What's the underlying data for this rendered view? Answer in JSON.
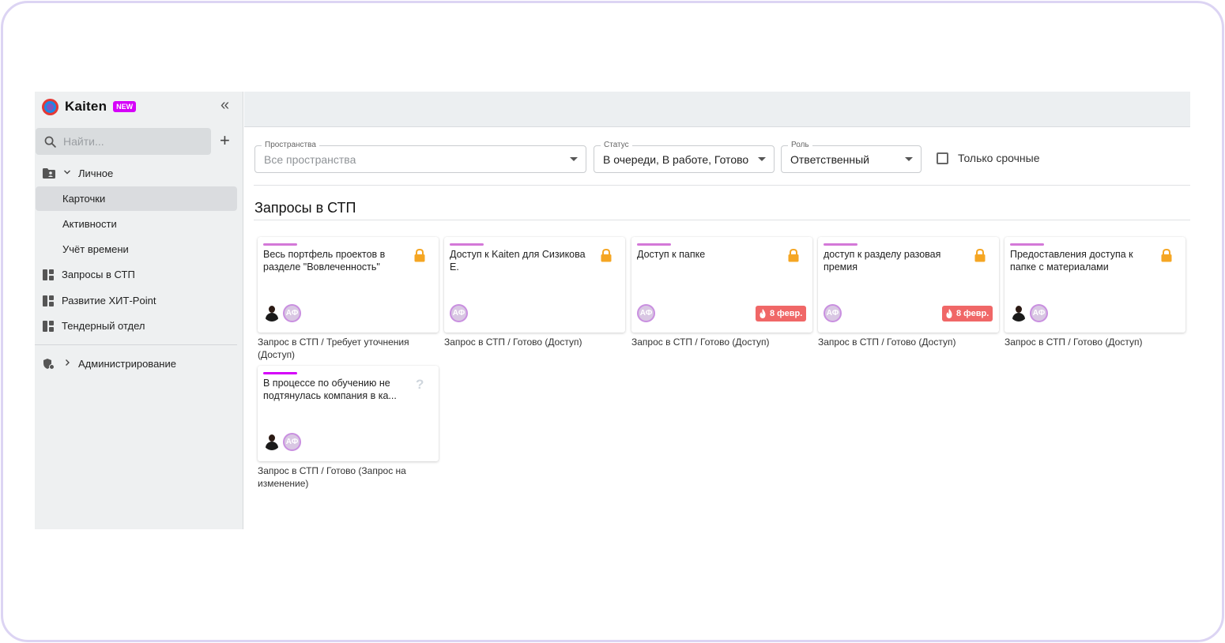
{
  "app": {
    "name": "Kaiten",
    "badge": "NEW",
    "collapse_glyph": "«"
  },
  "search": {
    "placeholder": "Найти..."
  },
  "sidebar": {
    "personal": {
      "label": "Личное"
    },
    "personal_items": [
      {
        "label": "Карточки",
        "active": true
      },
      {
        "label": "Активности"
      },
      {
        "label": "Учёт времени"
      }
    ],
    "spaces": [
      {
        "label": "Запросы в СТП",
        "icon": "board-icon"
      },
      {
        "label": "Развитие ХИТ-Point",
        "icon": "board-icon"
      },
      {
        "label": "Тендерный отдел",
        "icon": "board-icon"
      }
    ],
    "admin": {
      "label": "Администрирование",
      "icon": "admin-shield-icon"
    }
  },
  "filters": {
    "spaces": {
      "label": "Пространства",
      "placeholder": "Все пространства"
    },
    "status": {
      "label": "Статус",
      "value": "В очереди, В работе, Готово"
    },
    "role": {
      "label": "Роль",
      "value": "Ответственный"
    },
    "urgent": {
      "label": "Только срочные",
      "checked": false
    }
  },
  "section": {
    "title": "Запросы в СТП"
  },
  "colors": {
    "tag": "#d478d8",
    "tag_active": "#d500f9",
    "lock": "#f5a623",
    "due": "#f06767"
  },
  "cards": [
    {
      "title": "Весь портфель проектов в разделе \"Вовлеченность\"",
      "icon": "lock-icon",
      "has_photo": true,
      "initials": "АФ",
      "due": "",
      "caption": "Запрос в СТП / Требует уточнения (Доступ)"
    },
    {
      "title": "Доступ к Kaiten для Сизикова Е.",
      "icon": "lock-icon",
      "has_photo": false,
      "initials": "АФ",
      "due": "",
      "caption": "Запрос в СТП / Готово (Доступ)"
    },
    {
      "title": "Доступ к папке",
      "icon": "lock-icon",
      "has_photo": false,
      "initials": "АФ",
      "due": "8 февр.",
      "caption": "Запрос в СТП / Готово (Доступ)"
    },
    {
      "title": "доступ к разделу разовая премия",
      "icon": "lock-icon",
      "has_photo": false,
      "initials": "АФ",
      "due": "8 февр.",
      "caption": "Запрос в СТП / Готово (Доступ)"
    },
    {
      "title": "Предоставления доступа к папке с материалами",
      "icon": "lock-icon",
      "has_photo": true,
      "initials": "АФ",
      "due": "",
      "caption": "Запрос в СТП / Готово (Доступ)"
    },
    {
      "title": "В процессе по обучению не подтянулась компания в ка...",
      "icon": "question-icon",
      "has_photo": true,
      "initials": "АФ",
      "due": "",
      "caption": "Запрос в СТП / Готово (Запрос на изменение)"
    }
  ]
}
